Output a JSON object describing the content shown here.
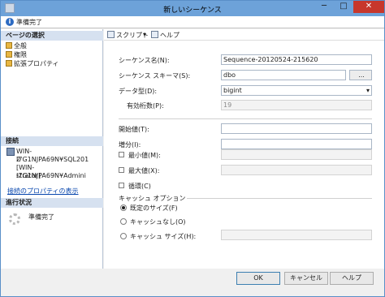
{
  "window": {
    "title": "新しいシーケンス",
    "min": "─",
    "max": "□",
    "close": "✕"
  },
  "status": {
    "icon": "i",
    "text": "準備完了"
  },
  "left": {
    "pages_header": "ページの選択",
    "pages": [
      "全般",
      "権限",
      "拡張プロパティ"
    ],
    "connection_header": "接続",
    "connection_lines": [
      "WIN-I7G1NJPA69N¥SQL201",
      "2",
      "[WIN-I7G1NJPA69N¥Admini",
      "strator]"
    ],
    "connection_link": "接続のプロパティの表示",
    "progress_header": "進行状況",
    "progress_text": "準備完了"
  },
  "toolbar": {
    "script": "スクリプト",
    "dropdown": "▾",
    "help": "ヘルプ"
  },
  "form": {
    "name_label": "シーケンス名(N):",
    "name_value": "Sequence-20120524-215620",
    "schema_label": "シーケンス スキーマ(S):",
    "schema_value": "dbo",
    "schema_browse": "...",
    "datatype_label": "データ型(D):",
    "datatype_value": "bigint",
    "precision_label": "有効桁数(P):",
    "precision_value": "19",
    "start_label": "開始値(T):",
    "increment_label": "増分(I):",
    "min_label": "最小値(M):",
    "max_label": "最大値(X):",
    "cycle_label": "循環(C)",
    "cache_group": "キャッシュ オプション",
    "cache_default": "既定のサイズ(F)",
    "cache_none": "キャッシュなし(O)",
    "cache_size": "キャッシュ サイズ(H):"
  },
  "buttons": {
    "ok": "OK",
    "cancel": "キャンセル",
    "help": "ヘルプ"
  }
}
